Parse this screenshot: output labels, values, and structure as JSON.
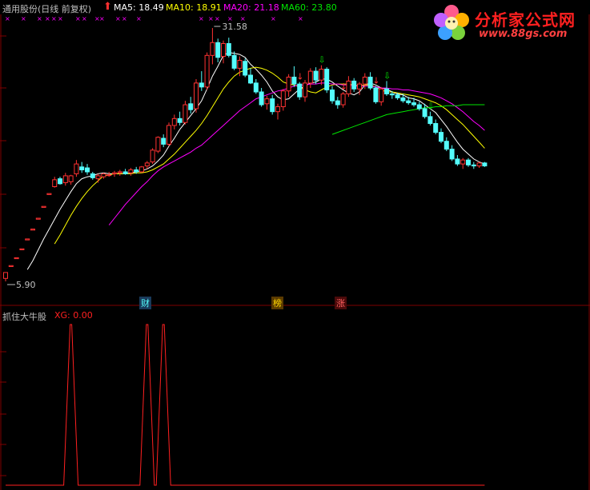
{
  "header": {
    "stock": "通用股份(日线 前复权)",
    "ma5": "MA5: 18.49",
    "ma10": "MA10: 18.91",
    "ma20": "MA20: 21.18",
    "ma60": "MA60: 23.80"
  },
  "annotations": {
    "high": "31.58",
    "low": "5.90"
  },
  "event_badges": [
    "财",
    "榜",
    "涨"
  ],
  "indicator": {
    "title": "抓住大牛股",
    "value": "XG: 0.00"
  },
  "watermark": {
    "brand": "分析家公式网",
    "url": "www.88gs.com"
  },
  "colors": {
    "up": "#ff3232",
    "down": "#54fcfc",
    "ma5": "#ffffff",
    "ma10": "#ffff00",
    "ma20": "#ff00ff",
    "ma60": "#00e600",
    "grid": "#800000",
    "indicator": "#ff2020"
  },
  "chart_data": [
    {
      "type": "candlestick",
      "title": "通用股份(日线 前复权)",
      "price_range": [
        5.9,
        31.58
      ],
      "high_label": 31.58,
      "low_label": 5.9,
      "candles": [
        [
          6.2,
          6.8,
          5.9,
          6.8
        ],
        [
          7.4,
          7.5,
          7.4,
          7.5
        ],
        [
          8.2,
          8.3,
          8.2,
          8.3
        ],
        [
          9.1,
          9.2,
          9.1,
          9.2
        ],
        [
          10.1,
          10.2,
          10.1,
          10.2
        ],
        [
          11.1,
          11.2,
          11.1,
          11.2
        ],
        [
          12.2,
          12.3,
          12.2,
          12.3
        ],
        [
          13.4,
          13.5,
          13.4,
          13.5
        ],
        [
          14.7,
          14.8,
          14.7,
          14.8
        ],
        [
          15.5,
          16.5,
          15.4,
          16.2
        ],
        [
          16.3,
          16.5,
          15.7,
          15.8
        ],
        [
          15.9,
          16.9,
          15.6,
          16.6
        ],
        [
          16.0,
          16.7,
          15.7,
          16.6
        ],
        [
          16.8,
          18.2,
          16.5,
          17.8
        ],
        [
          17.5,
          18.0,
          16.9,
          17.2
        ],
        [
          17.4,
          17.8,
          16.7,
          17.0
        ],
        [
          16.8,
          17.0,
          16.2,
          16.4
        ],
        [
          16.3,
          16.8,
          15.9,
          16.6
        ],
        [
          16.5,
          16.9,
          16.3,
          16.8
        ],
        [
          16.7,
          17.0,
          16.5,
          16.7
        ],
        [
          16.8,
          17.1,
          16.5,
          16.9
        ],
        [
          16.9,
          17.2,
          16.6,
          17.0
        ],
        [
          17.0,
          17.3,
          16.7,
          16.8
        ],
        [
          16.9,
          17.4,
          16.6,
          17.2
        ],
        [
          17.2,
          17.5,
          16.8,
          17.0
        ],
        [
          17.0,
          17.6,
          16.9,
          17.5
        ],
        [
          17.6,
          18.1,
          17.3,
          17.9
        ],
        [
          18.0,
          19.4,
          17.8,
          19.2
        ],
        [
          19.1,
          20.6,
          18.9,
          20.5
        ],
        [
          20.4,
          20.8,
          19.5,
          19.8
        ],
        [
          19.8,
          22.0,
          19.6,
          21.7
        ],
        [
          21.7,
          22.8,
          21.3,
          22.4
        ],
        [
          22.4,
          23.1,
          21.7,
          22.0
        ],
        [
          22.0,
          24.2,
          21.8,
          23.8
        ],
        [
          23.9,
          24.6,
          22.9,
          23.3
        ],
        [
          23.4,
          26.4,
          23.0,
          26.0
        ],
        [
          26.0,
          27.2,
          25.2,
          25.6
        ],
        [
          25.6,
          29.1,
          25.3,
          28.8
        ],
        [
          28.8,
          31.58,
          27.9,
          30.1
        ],
        [
          30.1,
          30.5,
          28.1,
          28.6
        ],
        [
          28.7,
          30.3,
          28.0,
          30.0
        ],
        [
          30.0,
          30.6,
          28.6,
          28.8
        ],
        [
          28.8,
          29.2,
          27.3,
          27.5
        ],
        [
          27.5,
          28.7,
          26.7,
          28.3
        ],
        [
          28.2,
          28.5,
          26.6,
          26.8
        ],
        [
          26.8,
          27.5,
          25.9,
          26.0
        ],
        [
          26.0,
          26.4,
          24.9,
          25.1
        ],
        [
          25.1,
          25.5,
          23.6,
          23.8
        ],
        [
          23.9,
          24.7,
          23.3,
          24.4
        ],
        [
          24.4,
          24.8,
          22.8,
          23.1
        ],
        [
          23.1,
          23.9,
          22.3,
          23.6
        ],
        [
          23.6,
          25.4,
          23.2,
          25.2
        ],
        [
          25.2,
          26.9,
          24.6,
          26.6
        ],
        [
          26.6,
          27.7,
          25.6,
          25.9
        ],
        [
          25.9,
          26.1,
          24.3,
          24.6
        ],
        [
          24.6,
          26.3,
          24.1,
          26.0
        ],
        [
          26.0,
          27.5,
          25.5,
          27.2
        ],
        [
          27.2,
          27.6,
          25.9,
          26.3
        ],
        [
          26.3,
          27.8,
          25.8,
          27.4
        ],
        [
          27.4,
          27.6,
          25.0,
          25.3
        ],
        [
          25.3,
          25.7,
          23.9,
          24.2
        ],
        [
          24.2,
          24.6,
          23.4,
          23.8
        ],
        [
          23.8,
          25.1,
          23.5,
          24.9
        ],
        [
          24.9,
          26.7,
          24.6,
          26.2
        ],
        [
          26.2,
          26.5,
          25.1,
          25.4
        ],
        [
          25.4,
          26.1,
          24.8,
          25.9
        ],
        [
          25.9,
          27.0,
          25.4,
          26.6
        ],
        [
          26.6,
          27.1,
          25.3,
          25.5
        ],
        [
          25.5,
          25.7,
          23.9,
          24.1
        ],
        [
          24.1,
          25.6,
          23.7,
          25.4
        ],
        [
          25.4,
          26.2,
          24.7,
          24.9
        ],
        [
          24.9,
          25.2,
          24.4,
          24.8
        ],
        [
          24.8,
          25.0,
          24.3,
          24.5
        ],
        [
          24.5,
          24.9,
          24.0,
          24.2
        ],
        [
          24.2,
          24.6,
          23.8,
          24.0
        ],
        [
          24.0,
          24.5,
          23.6,
          23.8
        ],
        [
          23.8,
          24.1,
          23.2,
          23.4
        ],
        [
          23.4,
          23.9,
          22.4,
          22.6
        ],
        [
          22.6,
          23.1,
          21.7,
          21.9
        ],
        [
          21.9,
          22.3,
          20.8,
          21.0
        ],
        [
          21.0,
          21.4,
          19.9,
          20.1
        ],
        [
          20.1,
          20.5,
          19.1,
          19.3
        ],
        [
          19.3,
          19.7,
          18.1,
          18.3
        ],
        [
          18.3,
          18.7,
          17.6,
          17.8
        ],
        [
          17.8,
          18.4,
          17.3,
          18.2
        ],
        [
          18.2,
          18.4,
          17.5,
          17.7
        ],
        [
          17.7,
          18.0,
          17.3,
          17.6
        ],
        [
          17.6,
          18.0,
          17.4,
          17.9
        ],
        [
          17.9,
          18.0,
          17.5,
          17.6
        ]
      ],
      "series": [
        {
          "name": "MA5",
          "last": 18.49,
          "values": [
            null,
            null,
            null,
            null,
            7.1,
            8.0,
            9.1,
            10.2,
            11.2,
            12.2,
            13.2,
            14.1,
            15.0,
            15.8,
            16.3,
            16.5,
            16.6,
            16.8,
            16.9,
            16.8,
            16.8,
            16.8,
            16.8,
            16.9,
            17.0,
            17.1,
            17.3,
            17.6,
            18.1,
            18.7,
            19.6,
            20.4,
            21.3,
            22.0,
            22.7,
            23.4,
            24.2,
            25.4,
            26.7,
            27.7,
            28.8,
            29.1,
            29.0,
            28.9,
            28.6,
            27.9,
            27.4,
            26.8,
            26.1,
            25.2,
            24.6,
            24.3,
            24.4,
            24.9,
            25.4,
            25.7,
            26.0,
            26.1,
            26.4,
            26.4,
            26.1,
            25.7,
            25.3,
            25.0,
            24.8,
            25.1,
            25.8,
            26.0,
            25.8,
            25.5,
            25.4,
            25.1,
            24.9,
            24.8,
            24.5,
            24.4,
            24.2,
            23.8,
            23.4,
            23.0,
            22.3,
            21.6,
            20.8,
            20.0,
            19.3,
            18.8,
            18.3,
            18.0,
            17.8
          ]
        },
        {
          "name": "MA10",
          "last": 18.91,
          "values": [
            null,
            null,
            null,
            null,
            null,
            null,
            null,
            null,
            null,
            9.7,
            10.6,
            11.6,
            12.6,
            13.5,
            14.3,
            15.0,
            15.6,
            16.1,
            16.6,
            16.7,
            16.8,
            16.8,
            16.8,
            16.8,
            16.9,
            16.9,
            17.0,
            17.2,
            17.5,
            17.8,
            18.3,
            18.8,
            19.4,
            20.0,
            20.6,
            21.2,
            21.9,
            22.7,
            23.6,
            24.5,
            25.4,
            26.1,
            26.7,
            27.1,
            27.3,
            27.5,
            27.6,
            27.5,
            27.3,
            27.0,
            26.6,
            26.1,
            25.9,
            25.8,
            25.6,
            25.3,
            25.1,
            25.0,
            25.3,
            25.6,
            25.8,
            25.9,
            25.9,
            25.9,
            25.8,
            25.7,
            25.8,
            25.8,
            25.6,
            25.3,
            25.1,
            25.1,
            25.0,
            24.9,
            24.8,
            24.7,
            24.6,
            24.4,
            24.2,
            24.0,
            23.7,
            23.3,
            22.8,
            22.3,
            21.8,
            21.2,
            20.6,
            20.0,
            19.4
          ]
        },
        {
          "name": "MA20",
          "last": 21.18,
          "values": [
            null,
            null,
            null,
            null,
            null,
            null,
            null,
            null,
            null,
            null,
            null,
            null,
            null,
            null,
            null,
            null,
            null,
            null,
            null,
            11.6,
            12.3,
            13.0,
            13.7,
            14.3,
            14.9,
            15.5,
            16.0,
            16.6,
            17.1,
            17.5,
            17.8,
            18.1,
            18.4,
            18.7,
            19.0,
            19.4,
            19.7,
            20.2,
            20.7,
            21.2,
            21.7,
            22.2,
            22.7,
            23.2,
            23.6,
            24.0,
            24.4,
            24.6,
            24.8,
            25.0,
            25.2,
            25.3,
            25.5,
            25.7,
            25.8,
            25.8,
            25.9,
            25.9,
            26.0,
            26.0,
            25.9,
            25.9,
            25.8,
            25.8,
            25.7,
            25.7,
            25.7,
            25.7,
            25.6,
            25.5,
            25.5,
            25.4,
            25.4,
            25.3,
            25.3,
            25.2,
            25.1,
            25.0,
            24.9,
            24.7,
            24.5,
            24.2,
            23.9,
            23.5,
            23.1,
            22.6,
            22.1,
            21.7,
            21.2
          ]
        },
        {
          "name": "MA60",
          "last": 23.8,
          "values": [
            null,
            null,
            null,
            null,
            null,
            null,
            null,
            null,
            null,
            null,
            null,
            null,
            null,
            null,
            null,
            null,
            null,
            null,
            null,
            null,
            null,
            null,
            null,
            null,
            null,
            null,
            null,
            null,
            null,
            null,
            null,
            null,
            null,
            null,
            null,
            null,
            null,
            null,
            null,
            null,
            null,
            null,
            null,
            null,
            null,
            null,
            null,
            null,
            null,
            null,
            null,
            null,
            null,
            null,
            null,
            null,
            null,
            null,
            null,
            null,
            20.8,
            21.0,
            21.2,
            21.4,
            21.6,
            21.8,
            22.0,
            22.2,
            22.4,
            22.6,
            22.8,
            22.9,
            23.0,
            23.1,
            23.2,
            23.3,
            23.4,
            23.5,
            23.5,
            23.6,
            23.6,
            23.7,
            23.7,
            23.7,
            23.8,
            23.8,
            23.8,
            23.8,
            23.8
          ]
        }
      ]
    },
    {
      "type": "line",
      "title": "抓住大牛股",
      "series": [
        {
          "name": "XG",
          "last": 0.0,
          "spikes_at_index": [
            12,
            26,
            29
          ]
        }
      ]
    }
  ]
}
